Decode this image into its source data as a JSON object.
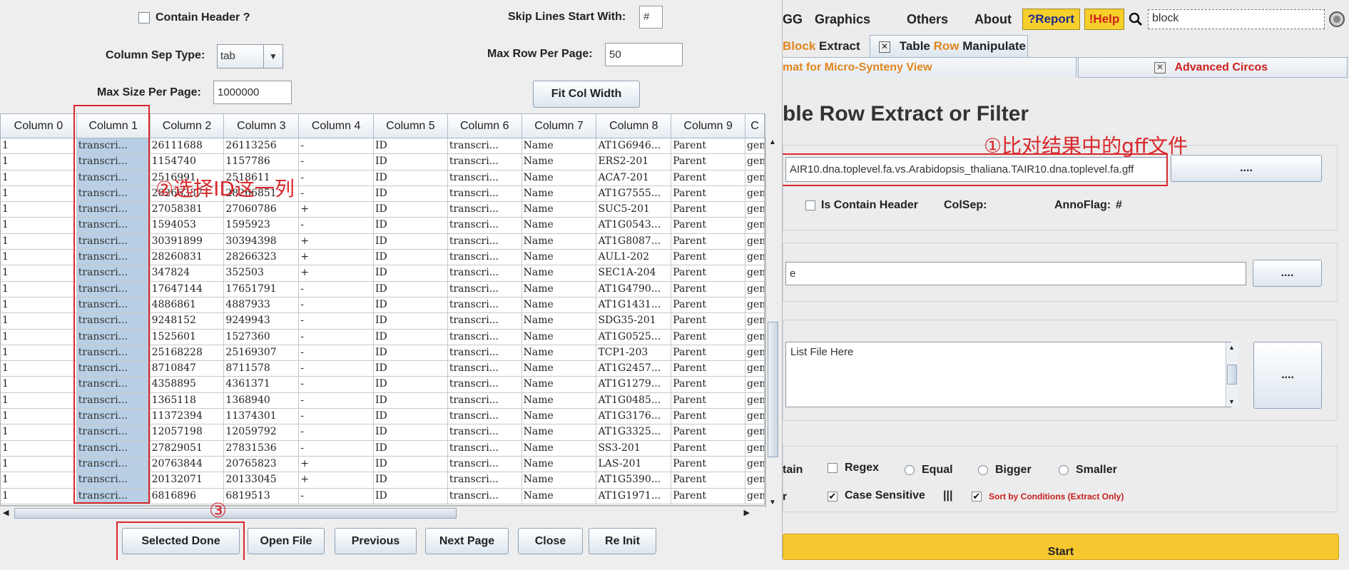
{
  "dialog": {
    "contain_header_label": "Contain Header ?",
    "skip_lines_label": "Skip Lines Start With:",
    "skip_lines_value": "#",
    "col_sep_label": "Column Sep Type:",
    "col_sep_value": "tab",
    "max_row_label": "Max Row Per Page:",
    "max_row_value": "50",
    "max_size_label": "Max Size Per Page:",
    "max_size_value": "1000000",
    "fit_col_width": "Fit Col Width",
    "columns": [
      "Column 0",
      "Column 1",
      "Column 2",
      "Column 3",
      "Column 4",
      "Column 5",
      "Column 6",
      "Column 7",
      "Column 8",
      "Column 9",
      "C"
    ],
    "rows": [
      [
        "1",
        "transcri...",
        "26111688",
        "26113256",
        "-",
        "ID",
        "transcri...",
        "Name",
        "AT1G6946...",
        "Parent",
        "gen"
      ],
      [
        "1",
        "transcri...",
        "1154740",
        "1157786",
        "-",
        "ID",
        "transcri...",
        "Name",
        "ERS2-201",
        "Parent",
        "gen"
      ],
      [
        "1",
        "transcri...",
        "2516991",
        "2518611",
        "-",
        "ID",
        "transcri...",
        "Name",
        "ACA7-201",
        "Parent",
        "gen"
      ],
      [
        "1",
        "transcri...",
        "28266337",
        "28266851",
        "-",
        "ID",
        "transcri...",
        "Name",
        "AT1G7555...",
        "Parent",
        "gen"
      ],
      [
        "1",
        "transcri...",
        "27058381",
        "27060786",
        "+",
        "ID",
        "transcri...",
        "Name",
        "SUC5-201",
        "Parent",
        "gen"
      ],
      [
        "1",
        "transcri...",
        "1594053",
        "1595923",
        "-",
        "ID",
        "transcri...",
        "Name",
        "AT1G0543...",
        "Parent",
        "gen"
      ],
      [
        "1",
        "transcri...",
        "30391899",
        "30394398",
        "+",
        "ID",
        "transcri...",
        "Name",
        "AT1G8087...",
        "Parent",
        "gen"
      ],
      [
        "1",
        "transcri...",
        "28260831",
        "28266323",
        "+",
        "ID",
        "transcri...",
        "Name",
        "AUL1-202",
        "Parent",
        "gen"
      ],
      [
        "1",
        "transcri...",
        "347824",
        "352503",
        "+",
        "ID",
        "transcri...",
        "Name",
        "SEC1A-204",
        "Parent",
        "gen"
      ],
      [
        "1",
        "transcri...",
        "17647144",
        "17651791",
        "-",
        "ID",
        "transcri...",
        "Name",
        "AT1G4790...",
        "Parent",
        "gen"
      ],
      [
        "1",
        "transcri...",
        "4886861",
        "4887933",
        "-",
        "ID",
        "transcri...",
        "Name",
        "AT1G1431...",
        "Parent",
        "gen"
      ],
      [
        "1",
        "transcri...",
        "9248152",
        "9249943",
        "-",
        "ID",
        "transcri...",
        "Name",
        "SDG35-201",
        "Parent",
        "gen"
      ],
      [
        "1",
        "transcri...",
        "1525601",
        "1527360",
        "-",
        "ID",
        "transcri...",
        "Name",
        "AT1G0525...",
        "Parent",
        "gen"
      ],
      [
        "1",
        "transcri...",
        "25168228",
        "25169307",
        "-",
        "ID",
        "transcri...",
        "Name",
        "TCP1-203",
        "Parent",
        "gen"
      ],
      [
        "1",
        "transcri...",
        "8710847",
        "8711578",
        "-",
        "ID",
        "transcri...",
        "Name",
        "AT1G2457...",
        "Parent",
        "gen"
      ],
      [
        "1",
        "transcri...",
        "4358895",
        "4361371",
        "-",
        "ID",
        "transcri...",
        "Name",
        "AT1G1279...",
        "Parent",
        "gen"
      ],
      [
        "1",
        "transcri...",
        "1365118",
        "1368940",
        "-",
        "ID",
        "transcri...",
        "Name",
        "AT1G0485...",
        "Parent",
        "gen"
      ],
      [
        "1",
        "transcri...",
        "11372394",
        "11374301",
        "-",
        "ID",
        "transcri...",
        "Name",
        "AT1G3176...",
        "Parent",
        "gen"
      ],
      [
        "1",
        "transcri...",
        "12057198",
        "12059792",
        "-",
        "ID",
        "transcri...",
        "Name",
        "AT1G3325...",
        "Parent",
        "gen"
      ],
      [
        "1",
        "transcri...",
        "27829051",
        "27831536",
        "-",
        "ID",
        "transcri...",
        "Name",
        "SS3-201",
        "Parent",
        "gen"
      ],
      [
        "1",
        "transcri...",
        "20763844",
        "20765823",
        "+",
        "ID",
        "transcri...",
        "Name",
        "LAS-201",
        "Parent",
        "gen"
      ],
      [
        "1",
        "transcri...",
        "20132071",
        "20133045",
        "+",
        "ID",
        "transcri...",
        "Name",
        "AT1G5390...",
        "Parent",
        "gen"
      ],
      [
        "1",
        "transcri...",
        "6816896",
        "6819513",
        "-",
        "ID",
        "transcri...",
        "Name",
        "AT1G1971...",
        "Parent",
        "gen"
      ]
    ],
    "buttons": {
      "selected_done": "Selected Done",
      "open_file": "Open File",
      "previous": "Previous",
      "next_page": "Next Page",
      "close": "Close",
      "re_init": "Re Init"
    }
  },
  "annotations": {
    "note1": "①比对结果中的gff文件",
    "note2": "②选择ID这一列",
    "note3": "③"
  },
  "menu": [
    "GG",
    "Graphics",
    "Others",
    "About"
  ],
  "toolbar": {
    "report": "?Report",
    "help": "!Help",
    "search_value": "block"
  },
  "tabs_row1": {
    "block_prefix": "Block",
    "block_suffix": " Extract",
    "table_row_a": "Table ",
    "table_row_b": "Row",
    "table_row_c": " Manipulate"
  },
  "tabs_row2": {
    "micro": "mat for Micro-Synteny View",
    "circos": "Advanced Circos"
  },
  "right": {
    "title": "ble Row Extract or Filter",
    "input_file": "AIR10.dna.toplevel.fa.vs.Arabidopsis_thaliana.TAIR10.dna.toplevel.fa.gff",
    "browse": "....",
    "is_contain_header": "Is Contain Header",
    "colsep": "ColSep:",
    "annoflag": "AnnoFlag:",
    "annoflag_value": "#",
    "second_field": "e",
    "list_placeholder": "List File Here",
    "tain": "tain",
    "regex": "Regex",
    "equal": "Equal",
    "bigger": "Bigger",
    "smaller": "Smaller",
    "r": "r",
    "case_sensitive": "Case Sensitive",
    "bars": "|||",
    "sort_by": "Sort by Conditions (Extract Only)",
    "start": "Start"
  },
  "colors": {
    "annotation_red": "#d9282c",
    "selection_blue": "#b8cfe5",
    "start_yellow": "#f7c730",
    "report_yellow": "#f6cf2a"
  }
}
